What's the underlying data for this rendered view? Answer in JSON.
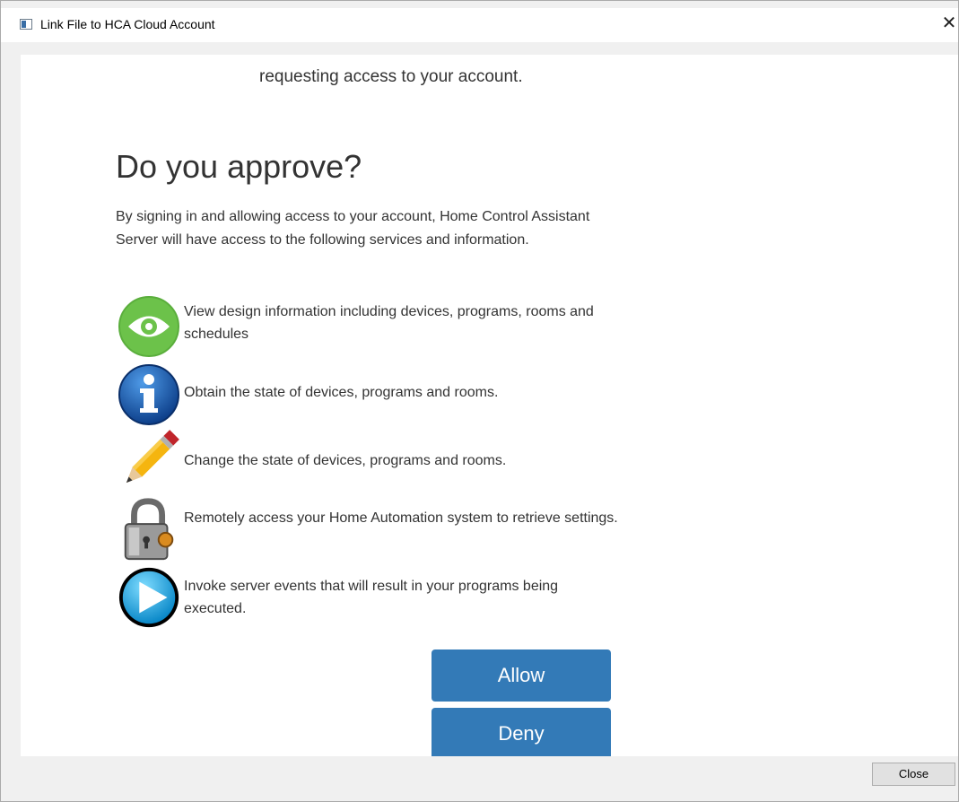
{
  "window": {
    "title": "Link File to HCA Cloud Account",
    "close_glyph": "✕"
  },
  "page": {
    "intro": "requesting access to your account.",
    "heading": "Do you approve?",
    "description": "By signing in and allowing access to your account, Home Control Assistant Server will have access to the following services and information.",
    "permissions": [
      {
        "icon": "eye-icon",
        "text": "View design information including devices, programs, rooms and schedules"
      },
      {
        "icon": "info-icon",
        "text": "Obtain the state of devices, programs and rooms."
      },
      {
        "icon": "pencil-icon",
        "text": "Change the state of devices, programs and rooms."
      },
      {
        "icon": "padlock-icon",
        "text": "Remotely access your Home Automation system to retrieve settings."
      },
      {
        "icon": "play-icon",
        "text": "Invoke server events that will result in your programs being executed."
      }
    ],
    "allow_label": "Allow",
    "deny_label": "Deny"
  },
  "footer": {
    "close_label": "Close"
  },
  "colors": {
    "button_primary": "#337ab7",
    "eye_green": "#6cc24a",
    "info_blue": "#1a5fb4"
  }
}
